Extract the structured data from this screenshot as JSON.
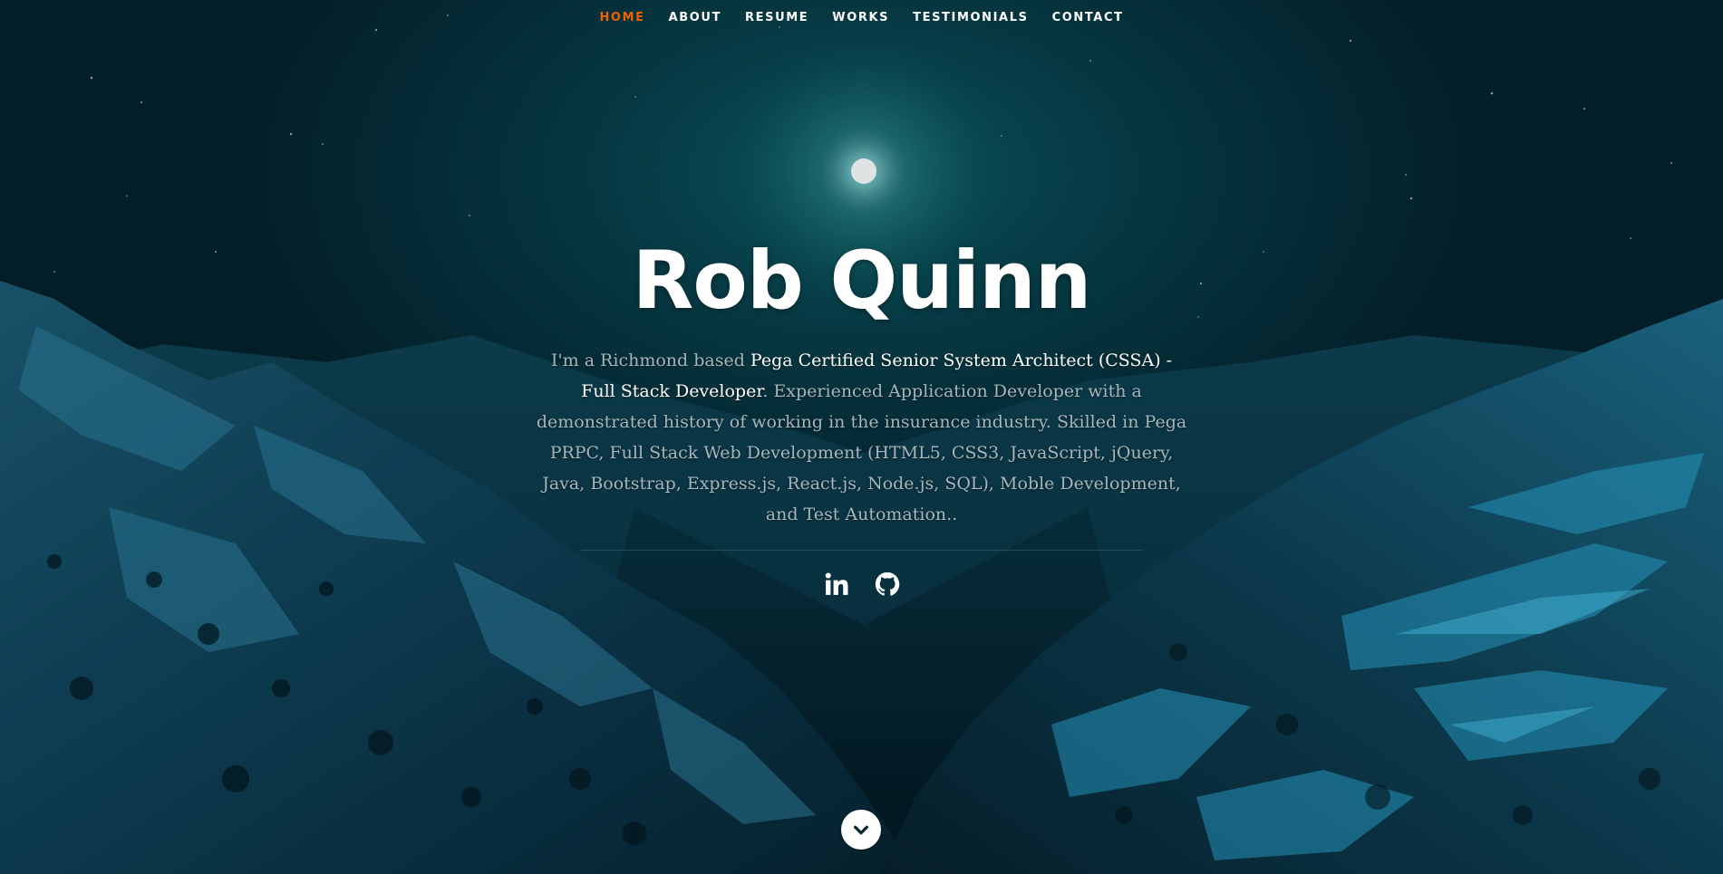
{
  "nav": {
    "items": [
      {
        "label": "HOME",
        "active": true
      },
      {
        "label": "ABOUT",
        "active": false
      },
      {
        "label": "RESUME",
        "active": false
      },
      {
        "label": "WORKS",
        "active": false
      },
      {
        "label": "TESTIMONIALS",
        "active": false
      },
      {
        "label": "CONTACT",
        "active": false
      }
    ]
  },
  "hero": {
    "name": "Rob Quinn",
    "intro": {
      "part1": "I'm a Richmond based ",
      "highlight": "Pega Certified Senior System Architect (CSSA) - Full Stack Developer",
      "part2": ". Experienced Application Developer with a demonstrated history of working in the insurance industry. Skilled in Pega PRPC, Full Stack Web Development (HTML5, CSS3, JavaScript, jQuery, Java, Bootstrap, Express.js, React.js, Node.js, SQL), Moble Development, and Test Automation.."
    }
  },
  "social": [
    {
      "icon": "linkedin-icon"
    },
    {
      "icon": "github-icon"
    }
  ],
  "scroll": {
    "icon": "chevron-down-icon"
  },
  "colors": {
    "accent": "#f06000",
    "text_primary": "#ffffff",
    "text_muted": "#a5b6bc",
    "background": "#052b36"
  }
}
